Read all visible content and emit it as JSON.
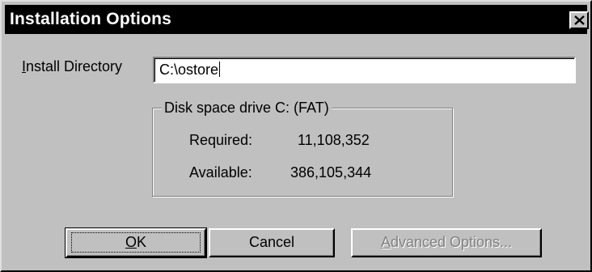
{
  "window": {
    "title": "Installation Options"
  },
  "install_directory": {
    "label_underlined": "I",
    "label_rest": "nstall Directory",
    "value": "C:\\ostore"
  },
  "disk_space": {
    "group_title": "Disk space drive C:  (FAT)",
    "required_label": "Required:",
    "required_value": "11,108,352",
    "available_label": "Available:",
    "available_value": "386,105,344"
  },
  "buttons": {
    "ok_underlined": "O",
    "ok_rest": "K",
    "cancel": "Cancel",
    "advanced_underlined": "A",
    "advanced_rest": "dvanced Options..."
  },
  "icons": {
    "close": "close-icon"
  },
  "colors": {
    "title_bar": "#000000",
    "face": "#c0c0c0",
    "disabled_text": "#808080"
  }
}
